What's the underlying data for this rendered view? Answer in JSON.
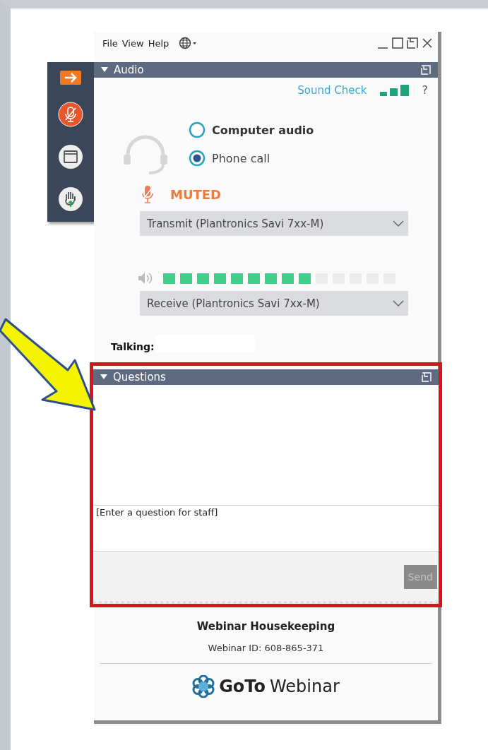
{
  "menu": [
    {
      "label": "File"
    },
    {
      "label": "View"
    },
    {
      "label": "Help"
    }
  ],
  "audio": {
    "title": "Audio",
    "sound_check": "Sound Check",
    "help": "?",
    "options": [
      {
        "label": "Computer audio",
        "selected": false,
        "highlighted": true
      },
      {
        "label": "Phone call",
        "selected": true,
        "highlighted": false
      }
    ],
    "muted": true,
    "status": "MUTED",
    "transmit": "Transmit (Plantronics Savi 7xx-M)",
    "level": 0.64,
    "receive": "Receive (Plantronics Savi 7xx-M)",
    "talking": "Talking:"
  },
  "questions": {
    "title": "Questions",
    "placeholder": "[Enter a question for staff]",
    "send": "Send",
    "send_disabled": true,
    "highlighted": true
  },
  "footer": {
    "title": "Webinar Housekeeping",
    "webinar_id": "Webinar ID: 608-865-371",
    "logo_bold": "GoTo",
    "logo_rest": "Webinar"
  }
}
